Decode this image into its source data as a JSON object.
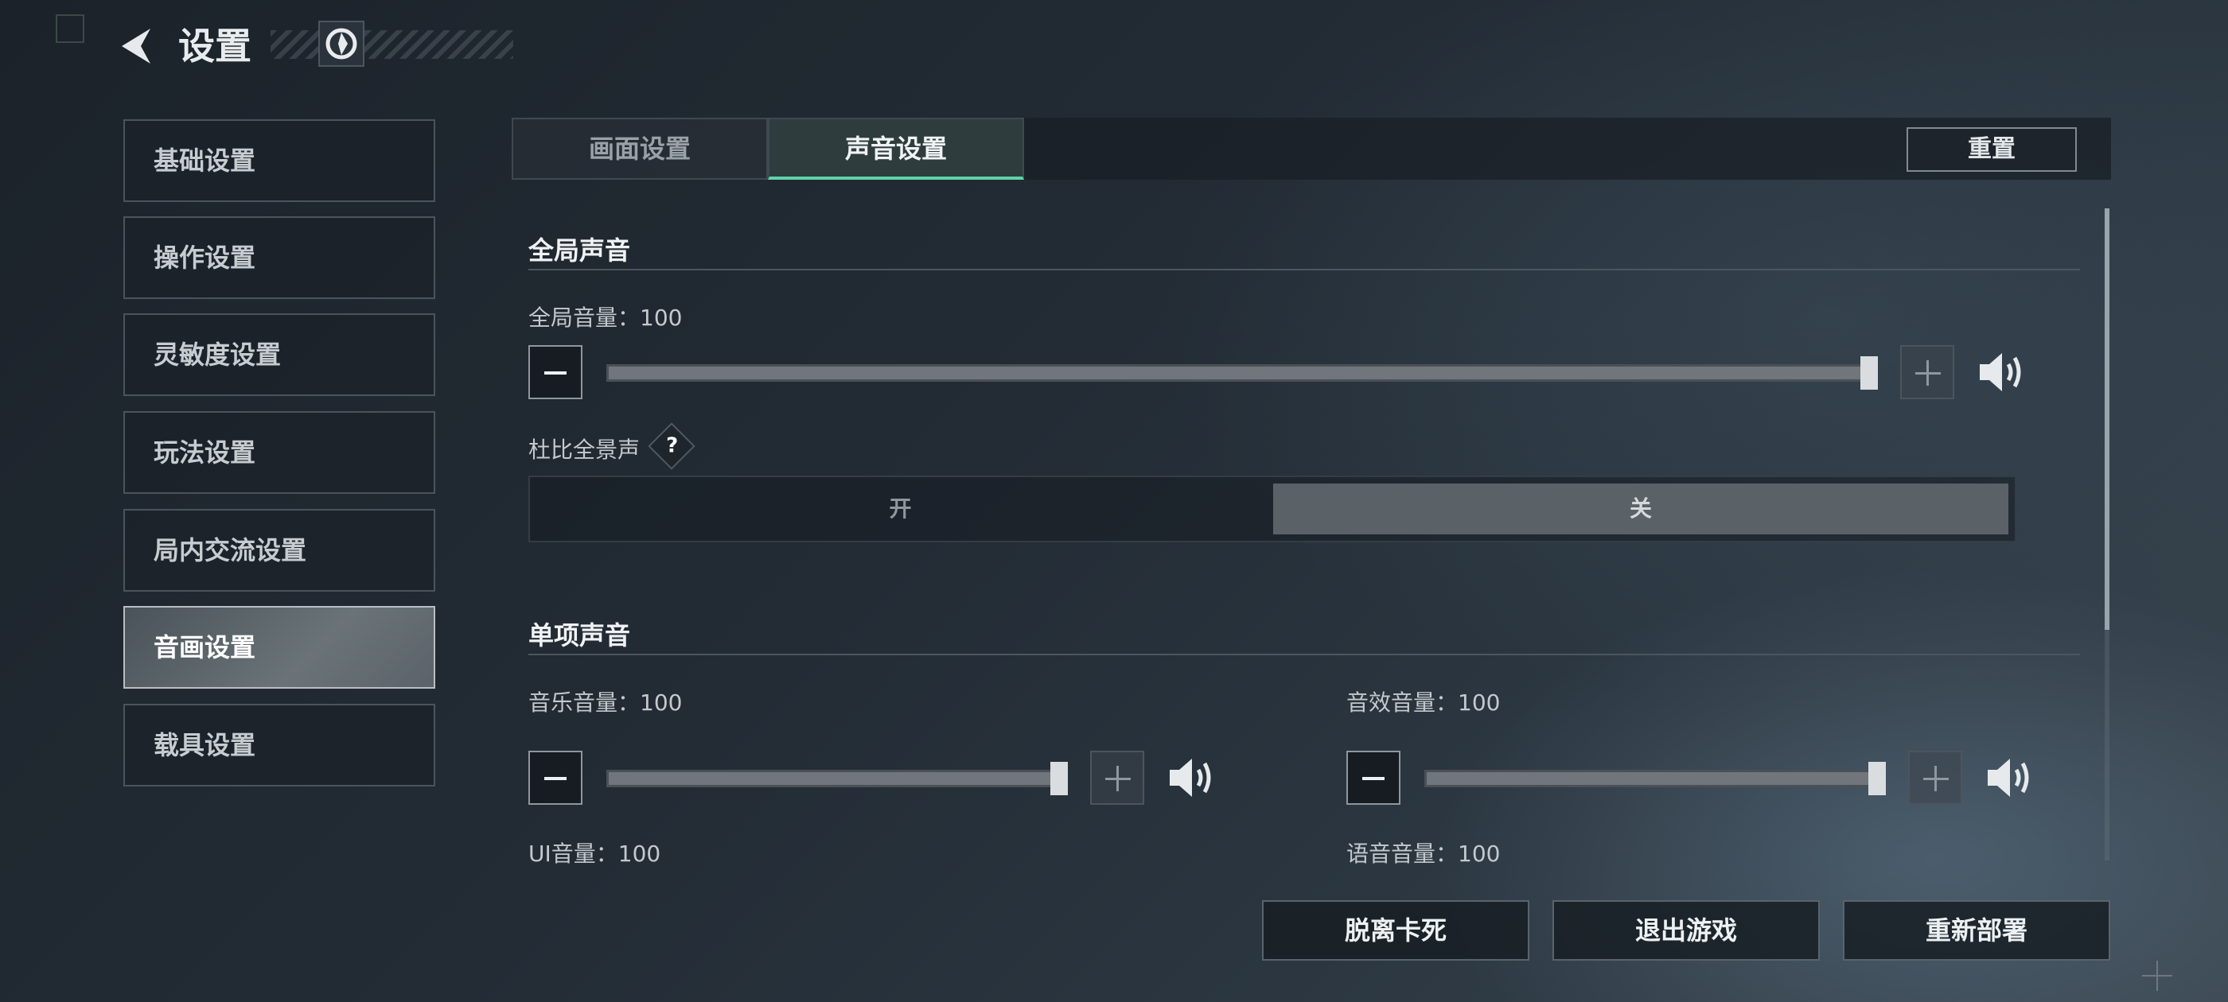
{
  "header": {
    "title": "设置"
  },
  "sidebar": {
    "items": [
      {
        "label": "基础设置"
      },
      {
        "label": "操作设置"
      },
      {
        "label": "灵敏度设置"
      },
      {
        "label": "玩法设置"
      },
      {
        "label": "局内交流设置"
      },
      {
        "label": "音画设置",
        "active": true
      },
      {
        "label": "载具设置"
      }
    ]
  },
  "tabs": [
    {
      "label": "画面设置"
    },
    {
      "label": "声音设置",
      "active": true
    }
  ],
  "reset_label": "重置",
  "global_sound": {
    "title": "全局声音",
    "master_volume": {
      "label": "全局音量：100",
      "value": 100,
      "max": 100
    },
    "dolby": {
      "label": "杜比全景声",
      "help": "?",
      "on_label": "开",
      "off_label": "关",
      "selected": "关"
    }
  },
  "individual_sound": {
    "title": "单项声音",
    "music_volume": {
      "label": "音乐音量：100",
      "value": 100,
      "max": 100
    },
    "sfx_volume": {
      "label": "音效音量：100",
      "value": 100,
      "max": 100
    },
    "ui_volume": {
      "label": "UI音量：100"
    },
    "voice_volume": {
      "label": "语音音量：100"
    }
  },
  "bottom_buttons": [
    {
      "label": "脱离卡死"
    },
    {
      "label": "退出游戏"
    },
    {
      "label": "重新部署"
    }
  ],
  "colors": {
    "tab_active_underline": "#5fd3a6",
    "active_sidebar": "#6a7377"
  }
}
